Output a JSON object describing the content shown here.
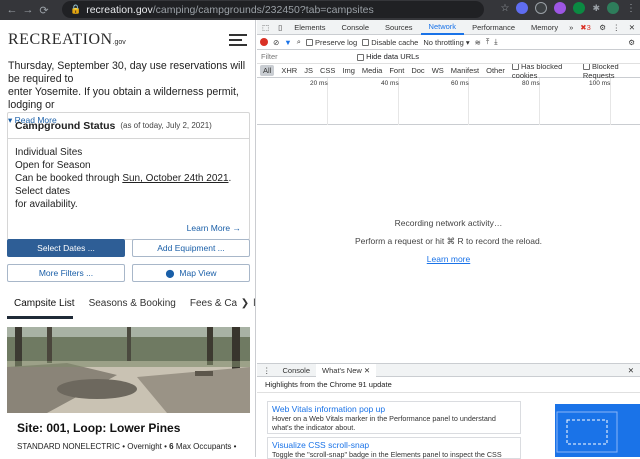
{
  "browser": {
    "url_host": "recreation.gov",
    "url_path": "/camping/campgrounds/232450?tab=campsites"
  },
  "site": {
    "logo_main": "RECREATION",
    "logo_suffix": ".gov",
    "alert_lines": [
      "Thursday, September 30, day use reservations will be required to",
      "enter Yosemite. If you obtain a wilderness permit, lodging or"
    ],
    "read_more": "Read More",
    "status": {
      "title": "Campground Status",
      "subtitle": "(as of today, July 2, 2021)",
      "line1": "Individual Sites",
      "line2": "Open for Season",
      "line3_prefix": "Can be booked through ",
      "line3_date": "Sun, October 24th 2021",
      "line3_suffix": ". Select dates",
      "line4": "for availability.",
      "learn_more": "Learn More"
    },
    "buttons": {
      "select_dates": "Select Dates ...",
      "add_equipment": "Add Equipment ...",
      "more_filters": "More Filters ...",
      "map_view": "Map View"
    },
    "tabs": [
      "Campsite List",
      "Seasons & Booking",
      "Fees & Cancellatio"
    ],
    "site_title": "Site: 001, Loop: Lower Pines",
    "site_meta_prefix": "STANDARD NONELECTRIC • Overnight • ",
    "site_meta_occupants_num": "6",
    "site_meta_occupants_label": " Max Occupants •"
  },
  "devtools": {
    "tabs": [
      "Elements",
      "Console",
      "Sources",
      "Network",
      "Performance",
      "Memory"
    ],
    "more_tabs": "»",
    "error_count": "3",
    "preserve_log": "Preserve log",
    "disable_cache": "Disable cache",
    "throttling": "No throttling",
    "filter_placeholder": "Filter",
    "hide_data_urls": "Hide data URLs",
    "types": [
      "All",
      "XHR",
      "JS",
      "CSS",
      "Img",
      "Media",
      "Font",
      "Doc",
      "WS",
      "Manifest",
      "Other"
    ],
    "has_blocked_cookies": "Has blocked cookies",
    "blocked_requests": "Blocked Requests",
    "timeline_labels": [
      "20 ms",
      "40 ms",
      "60 ms",
      "80 ms",
      "100 ms"
    ],
    "recording_line1": "Recording network activity…",
    "recording_line2": "Perform a request or hit ⌘ R to record the reload.",
    "learn_more": "Learn more",
    "drawer_tabs": [
      "Console",
      "What's New"
    ],
    "highlights": "Highlights from the Chrome 91 update",
    "whats_new": [
      {
        "title": "Web Vitals information pop up",
        "desc1": "Hover on a Web Vitals marker in the Performance panel to understand",
        "desc2": "what's the indicator about."
      },
      {
        "title": "Visualize CSS scroll-snap",
        "desc1": "Toggle the \"scroll-snap\" badge in the Elements panel to inspect the CSS",
        "desc2": ""
      }
    ]
  },
  "colors": {
    "accent_blue": "#1a73e8",
    "primary_button": "#2e5e96",
    "chrome_dark": "#35363a"
  }
}
